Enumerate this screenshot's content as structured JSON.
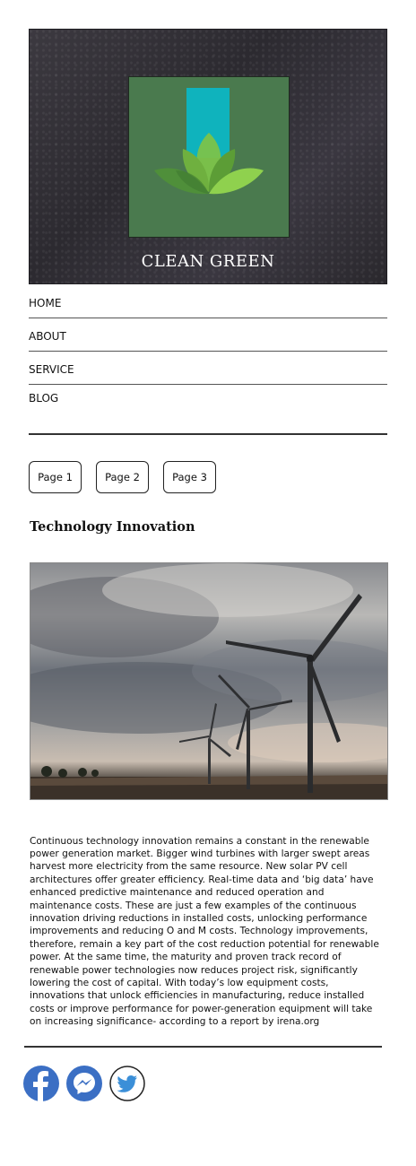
{
  "brand": {
    "name": "CLEAN GREEN"
  },
  "nav": {
    "items": [
      {
        "label": "HOME"
      },
      {
        "label": "ABOUT"
      },
      {
        "label": "SERVICE"
      },
      {
        "label": "BLOG"
      }
    ]
  },
  "pager": {
    "pages": [
      {
        "label": "Page 1"
      },
      {
        "label": "Page 2"
      },
      {
        "label": "Page 3"
      }
    ]
  },
  "article": {
    "title": "Technology Innovation",
    "body": "Continuous technology innovation remains a constant in the renewable power generation market. Bigger wind turbines with larger swept areas harvest more electricity from the same resource. New solar PV cell architectures offer greater efficiency. Real-time data and ‘big data’ have enhanced predictive maintenance and reduced operation and maintenance costs. These are just a few examples of the continuous innovation driving reductions in installed costs, unlocking performance improvements and reducing O and M costs. Technology improvements, therefore, remain a key part of the cost reduction potential for renewable power. At the same time, the maturity and proven track record of renewable power technologies now reduces project risk, significantly lowering the cost of capital. With today’s low equipment costs, innovations that unlock efficiencies in manufacturing, reduce installed costs or improve performance for power-generation equipment will take on increasing significance- according to a report by irena.org"
  },
  "social": {
    "icons": [
      "facebook-icon",
      "messenger-icon",
      "twitter-icon"
    ],
    "colors": {
      "facebook": "#3b6fc4",
      "messenger": "#3b6fc4",
      "twitter": "#3b8fd8"
    }
  },
  "colors": {
    "logo_bg": "#4a7a4e",
    "logo_bar": "#0fb3bd",
    "leaf_light": "#7cc34a",
    "leaf_dark": "#4f8f3a"
  }
}
